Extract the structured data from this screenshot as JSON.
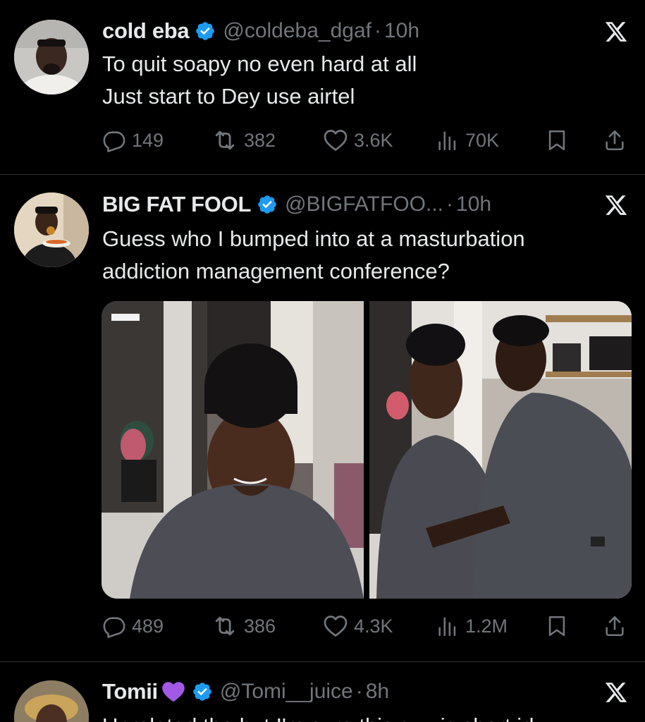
{
  "tweets": [
    {
      "name": "cold eba",
      "handle": "@coldeba_dgaf",
      "dot": "·",
      "time": "10h",
      "lines": [
        "To quit soapy no even hard at all",
        "Just start to Dey use airtel"
      ],
      "stats": {
        "replies": "149",
        "reposts": "382",
        "likes": "3.6K",
        "views": "70K"
      }
    },
    {
      "name": "BIG FAT FOOL",
      "handle": "@BIGFATFOO...",
      "dot": "·",
      "time": "10h",
      "lines": [
        "Guess who I bumped into at a masturbation",
        "addiction management conference?"
      ],
      "stats": {
        "replies": "489",
        "reposts": "386",
        "likes": "4.3K",
        "views": "1.2M"
      }
    },
    {
      "name": "Tomii",
      "handle": "@Tomi__juice",
      "dot": "·",
      "time": "8h",
      "lines": [
        "Unrelated tho but I'm sure this guy is short id"
      ]
    }
  ],
  "icons": {
    "verified": "verified-badge-icon",
    "close": "x-logo-icon",
    "reply": "reply-icon",
    "repost": "repost-icon",
    "like": "heart-icon",
    "views": "views-icon",
    "bookmark": "bookmark-icon",
    "share": "share-icon",
    "emoji": "purple-heart-emoji"
  },
  "colors": {
    "background": "#000000",
    "text": "#e7e9ea",
    "muted": "#71767b",
    "verified": "#1d9bf0",
    "divider": "#2f3336"
  }
}
